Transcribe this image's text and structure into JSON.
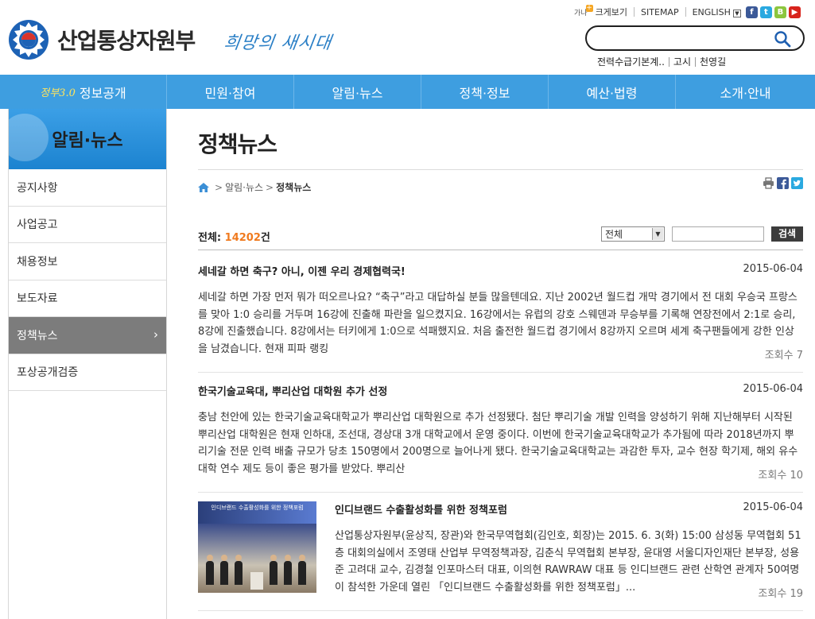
{
  "header": {
    "ministry_name": "산업통상자원부",
    "slogan": "희망의 새시대",
    "util": {
      "zoom_label": "크게보기",
      "zoom_icon_text": "가나",
      "sitemap": "SITEMAP",
      "english": "ENGLISH"
    },
    "social": [
      {
        "name": "facebook-icon",
        "glyph": "f",
        "color": "#3b5998"
      },
      {
        "name": "twitter-icon",
        "glyph": "t",
        "color": "#2aa9e0"
      },
      {
        "name": "blog-icon",
        "glyph": "B",
        "color": "#8cc63e"
      },
      {
        "name": "youtube-icon",
        "glyph": "▶",
        "color": "#d8241c"
      }
    ],
    "search": {
      "placeholder": "",
      "value": ""
    },
    "keywords": [
      "전력수급기본계..",
      "고시",
      "천영길"
    ]
  },
  "gnb": {
    "gov30": "정부3.0",
    "items": [
      "정보공개",
      "민원·참여",
      "알림·뉴스",
      "정책·정보",
      "예산·법령",
      "소개·안내"
    ]
  },
  "sidebar": {
    "title": "알림·뉴스",
    "items": [
      "공지사항",
      "사업공고",
      "채용정보",
      "보도자료",
      "정책뉴스",
      "포상공개검증"
    ],
    "active_index": 4,
    "arrow": "›"
  },
  "content": {
    "page_title": "정책뉴스",
    "breadcrumb": {
      "parent": "알림·뉴스",
      "current": "정책뉴스",
      "sep": ">"
    },
    "count": {
      "label": "전체:",
      "number": "14202",
      "unit": "건"
    },
    "filter": {
      "select_value": "전체",
      "button_label": "검색"
    },
    "posts": [
      {
        "title": "세네갈 하면 축구? 아니, 이젠 우리 경제협력국!",
        "date": "2015-06-04",
        "body": "세네갈 하면 가장 먼저 뭐가 떠오르나요? “축구”라고 대답하실 분들 많을텐데요. 지난 2002년 월드컵 개막 경기에서 전 대회 우승국 프랑스를 맞아 1:0 승리를 거두며 16강에 진출해 파란을 일으켰지요. 16강에서는 유럽의 강호 스웨덴과 무승부를 기록해 연장전에서 2:1로 승리, 8강에 진출했습니다. 8강에서는 터키에게 1:0으로 석패했지요. 처음 출전한 월드컵 경기에서 8강까지 오르며 세계 축구팬들에게 강한 인상을 남겼습니다. 현재 피파 랭킹",
        "views_label": "조회수",
        "views": "7"
      },
      {
        "title": "한국기술교육대, 뿌리산업 대학원 추가 선정",
        "date": "2015-06-04",
        "body": "충남 천안에 있는 한국기술교육대학교가 뿌리산업 대학원으로 추가 선정됐다. 첨단 뿌리기술 개발 인력을 양성하기 위해 지난해부터 시작된 뿌리산업 대학원은 현재 인하대, 조선대, 경상대 3개 대학교에서 운영 중이다. 이번에 한국기술교육대학교가 추가됨에 따라 2018년까지 뿌리기술 전문 인력 배출 규모가 당초 150명에서 200명으로 늘어나게 됐다. 한국기술교육대학교는 과감한 투자, 교수 현장 학기제, 해외 유수대학 연수 제도 등이 좋은 평가를 받았다. 뿌리산",
        "views_label": "조회수",
        "views": "10"
      },
      {
        "title": "인디브랜드 수출활성화를 위한 정책포럼",
        "date": "2015-06-04",
        "body": "산업통상자원부(윤상직, 장관)와 한국무역협회(김인호, 회장)는 2015. 6. 3(화) 15:00 삼성동 무역협회 51층 대회의실에서 조영태 산업부 무역정책과장, 김춘식 무역협회 본부장, 윤대영 서울디자인재단 본부장, 성용준 고려대 교수, 김경철 인포마스터 대표, 이의현 RAWRAW 대표 등 인디브랜드 관련 산학연 관계자 50여명이 참석한 가운데 열린 「인디브랜드 수출활성화를 위한 정책포럼」...",
        "views_label": "조회수",
        "views": "19",
        "thumb_caption": "인디브랜드 수출활성화를 위한 정책포럼"
      }
    ]
  }
}
